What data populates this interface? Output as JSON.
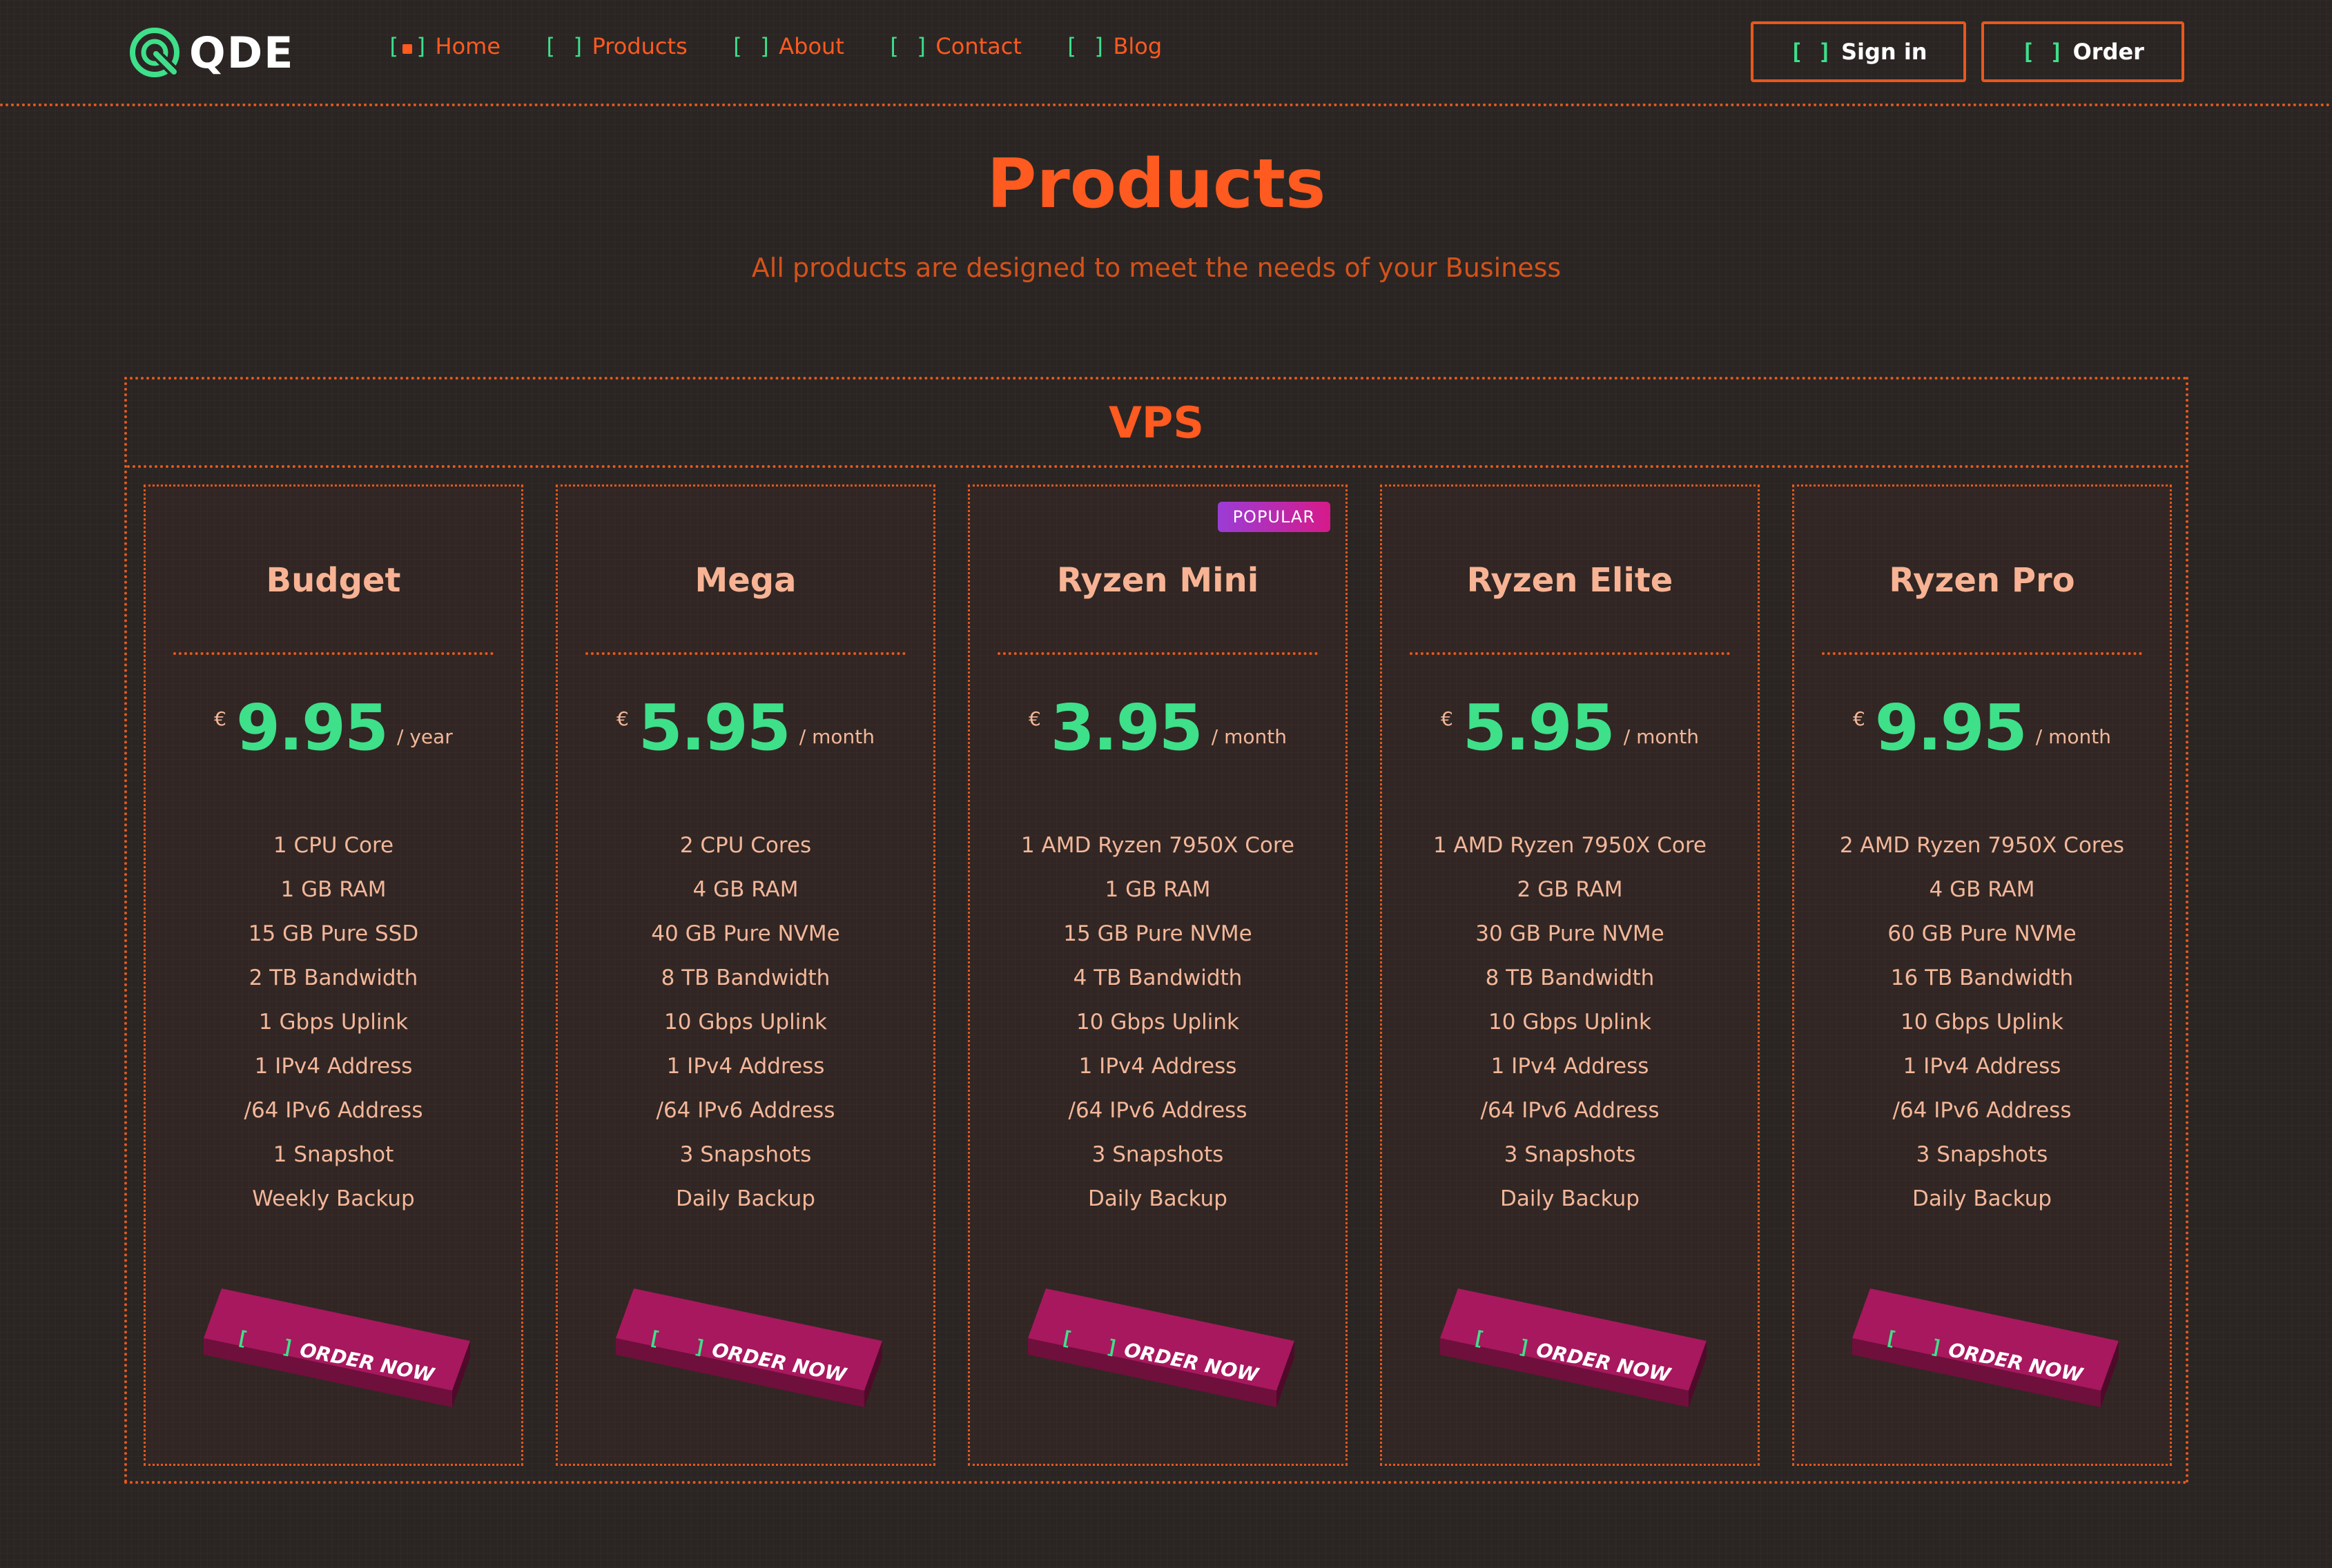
{
  "header": {
    "logo_text": "QDE",
    "nav": [
      {
        "label": "Home",
        "active": true
      },
      {
        "label": "Products",
        "active": false
      },
      {
        "label": "About",
        "active": false
      },
      {
        "label": "Contact",
        "active": false
      },
      {
        "label": "Blog",
        "active": false
      }
    ],
    "sign_in_label": "Sign in",
    "order_label": "Order"
  },
  "page": {
    "title": "Products",
    "subtitle": "All products are designed to meet the needs of your Business"
  },
  "section": {
    "title": "VPS"
  },
  "plans": [
    {
      "name": "Budget",
      "currency": "€",
      "price": "9.95",
      "period": "/ year",
      "badge": "",
      "features": [
        "1 CPU Core",
        "1 GB RAM",
        "15 GB Pure SSD",
        "2 TB Bandwidth",
        "1 Gbps Uplink",
        "1 IPv4 Address",
        "/64 IPv6 Address",
        "1 Snapshot",
        "Weekly Backup"
      ],
      "cta": "ORDER NOW"
    },
    {
      "name": "Mega",
      "currency": "€",
      "price": "5.95",
      "period": "/ month",
      "badge": "",
      "features": [
        "2 CPU Cores",
        "4 GB RAM",
        "40 GB Pure NVMe",
        "8 TB Bandwidth",
        "10 Gbps Uplink",
        "1 IPv4 Address",
        "/64 IPv6 Address",
        "3 Snapshots",
        "Daily Backup"
      ],
      "cta": "ORDER NOW"
    },
    {
      "name": "Ryzen Mini",
      "currency": "€",
      "price": "3.95",
      "period": "/ month",
      "badge": "POPULAR",
      "features": [
        "1 AMD Ryzen 7950X Core",
        "1 GB RAM",
        "15 GB Pure NVMe",
        "4 TB Bandwidth",
        "10 Gbps Uplink",
        "1 IPv4 Address",
        "/64 IPv6 Address",
        "3 Snapshots",
        "Daily Backup"
      ],
      "cta": "ORDER NOW"
    },
    {
      "name": "Ryzen Elite",
      "currency": "€",
      "price": "5.95",
      "period": "/ month",
      "badge": "",
      "features": [
        "1 AMD Ryzen 7950X Core",
        "2 GB RAM",
        "30 GB Pure NVMe",
        "8 TB Bandwidth",
        "10 Gbps Uplink",
        "1 IPv4 Address",
        "/64 IPv6 Address",
        "3 Snapshots",
        "Daily Backup"
      ],
      "cta": "ORDER NOW"
    },
    {
      "name": "Ryzen Pro",
      "currency": "€",
      "price": "9.95",
      "period": "/ month",
      "badge": "",
      "features": [
        "2 AMD Ryzen 7950X Cores",
        "4 GB RAM",
        "60 GB Pure NVMe",
        "16 TB Bandwidth",
        "10 Gbps Uplink",
        "1 IPv4 Address",
        "/64 IPv6 Address",
        "3 Snapshots",
        "Daily Backup"
      ],
      "cta": "ORDER NOW"
    }
  ],
  "colors": {
    "background": "#2a2523",
    "accent_orange": "#ff5a1f",
    "accent_green": "#3ee08a",
    "card_text": "#f3b79a",
    "cta_magenta": "#a8185e",
    "badge_gradient": [
      "#9b3cd6",
      "#d61a8a"
    ]
  },
  "icons": {
    "logo": "qde-logo-icon",
    "nav_bracket": "bracket-icon"
  }
}
